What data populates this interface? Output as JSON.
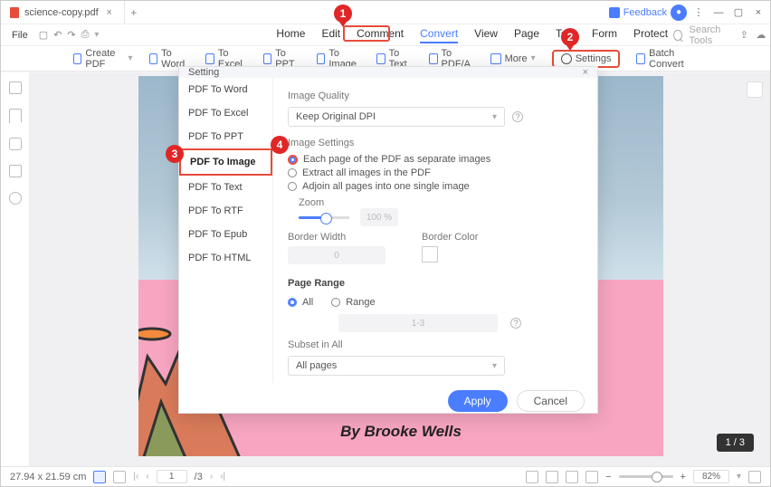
{
  "titlebar": {
    "tab_name": "science-copy.pdf",
    "feedback_label": "Feedback"
  },
  "filerow": {
    "file_label": "File",
    "search_placeholder": "Search Tools"
  },
  "mainmenu": {
    "items": [
      "Home",
      "Edit",
      "Comment",
      "Convert",
      "View",
      "Page",
      "Tool",
      "Form",
      "Protect"
    ],
    "active": "Convert"
  },
  "ribbon": {
    "create": "Create PDF",
    "to_word": "To Word",
    "to_excel": "To Excel",
    "to_ppt": "To PPT",
    "to_image": "To Image",
    "to_text": "To Text",
    "to_pdfa": "To PDF/A",
    "more": "More",
    "settings": "Settings",
    "batch": "Batch Convert"
  },
  "dialog": {
    "title": "Setting",
    "side": [
      "PDF To Word",
      "PDF To Excel",
      "PDF To PPT",
      "PDF To Image",
      "PDF To Text",
      "PDF To RTF",
      "PDF To Epub",
      "PDF To HTML"
    ],
    "image_quality_h": "Image Quality",
    "image_quality_val": "Keep Original DPI",
    "image_settings_h": "Image Settings",
    "opt1": "Each page of the PDF as separate images",
    "opt2": "Extract all images in the PDF",
    "opt3": "Adjoin all pages into one single image",
    "zoom_h": "Zoom",
    "zoom_val": "100 %",
    "bw_h": "Border Width",
    "bw_val": "0",
    "bc_h": "Border Color",
    "page_range_h": "Page Range",
    "all_label": "All",
    "range_label": "Range",
    "range_hint": "1-3",
    "subset_h": "Subset in All",
    "subset_val": "All pages",
    "apply": "Apply",
    "cancel": "Cancel"
  },
  "callouts": {
    "c1": "1",
    "c2": "2",
    "c3": "3",
    "c4": "4"
  },
  "document": {
    "byline": "By Brooke Wells",
    "page_indicator": "1 / 3"
  },
  "status": {
    "dims": "27.94 x 21.59 cm",
    "page": "1",
    "total": "/3",
    "zoom": "82%"
  }
}
